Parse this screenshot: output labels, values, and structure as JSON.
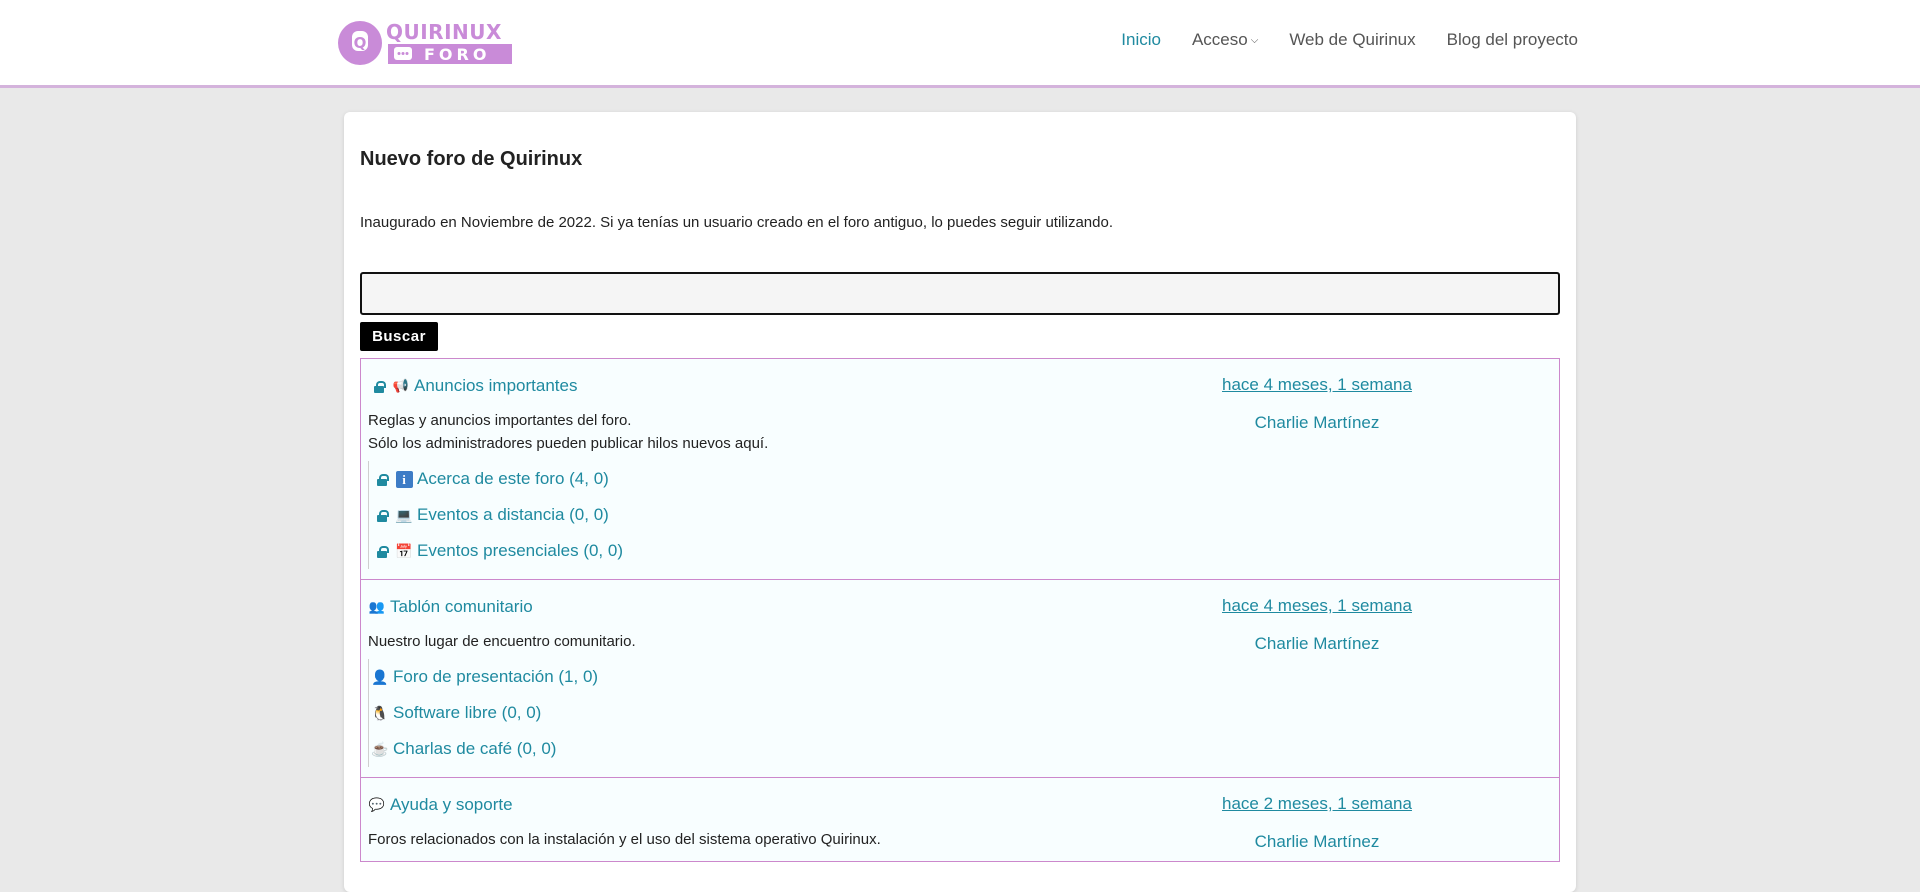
{
  "header": {
    "logo_text_top": "QUIRINUX",
    "logo_text_bottom": "FORO",
    "logo_letter": "Q",
    "nav": [
      {
        "label": "Inicio",
        "active": true
      },
      {
        "label": "Acceso",
        "dropdown": true
      },
      {
        "label": "Web de Quirinux"
      },
      {
        "label": "Blog del proyecto"
      }
    ]
  },
  "main": {
    "title": "Nuevo foro de Quirinux",
    "intro": "Inaugurado en Noviembre de 2022. Si ya tenías un usuario creado en el foro antiguo, lo puedes seguir utilizando.",
    "search": {
      "value": "",
      "placeholder": "",
      "button_label": "Buscar"
    }
  },
  "categories": [
    {
      "title": "Anuncios importantes",
      "icon": "megaphone-icon",
      "locked": true,
      "description": [
        "Reglas y anuncios importantes del foro.",
        "Sólo los administradores pueden publicar hilos nuevos aquí."
      ],
      "last_time": "hace 4 meses, 1 semana",
      "last_user": "Charlie Martínez",
      "subforums": [
        {
          "label": "Acerca de este foro (4, 0)",
          "icon": "info-icon",
          "locked": true
        },
        {
          "label": "Eventos a distancia (0, 0)",
          "icon": "laptop-icon",
          "locked": true
        },
        {
          "label": "Eventos presenciales (0, 0)",
          "icon": "calendar-icon",
          "locked": true
        }
      ]
    },
    {
      "title": "Tablón comunitario",
      "icon": "people-talking-icon",
      "locked": false,
      "description": [
        "Nuestro lugar de encuentro comunitario."
      ],
      "last_time": "hace 4 meses, 1 semana",
      "last_user": "Charlie Martínez",
      "subforums": [
        {
          "label": "Foro de presentación (1, 0)",
          "icon": "person-icon",
          "locked": false
        },
        {
          "label": "Software libre (0, 0)",
          "icon": "penguin-icon",
          "locked": false
        },
        {
          "label": "Charlas de café (0, 0)",
          "icon": "coffee-icon",
          "locked": false
        }
      ]
    },
    {
      "title": "Ayuda y soporte",
      "icon": "speech-bubble-icon",
      "locked": false,
      "description": [
        "Foros relacionados con la instalación y el uso del sistema operativo Quirinux."
      ],
      "last_time": "hace 2 meses, 1 semana",
      "last_user": "Charlie Martínez",
      "subforums": []
    }
  ],
  "colors": {
    "link": "#1f8aa0",
    "border": "#cc88cc",
    "logo": "#c98bd8",
    "header_border": "#d4b3dc"
  }
}
